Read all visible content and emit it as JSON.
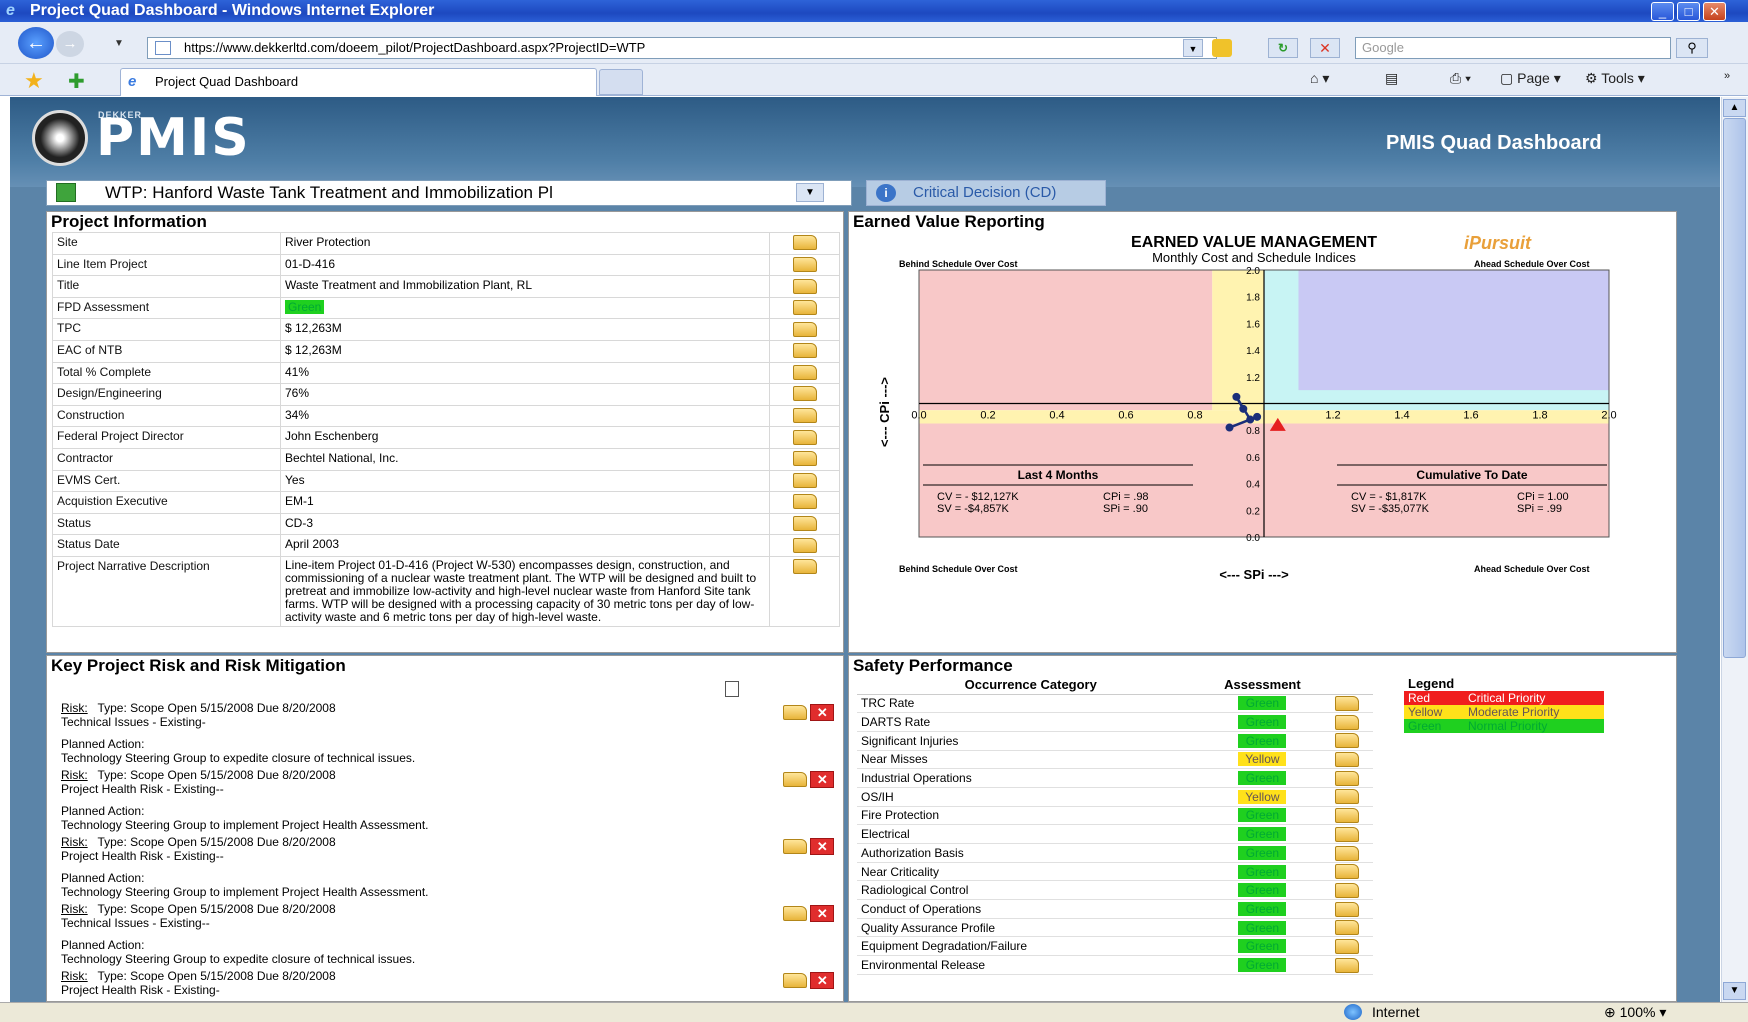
{
  "window": {
    "title": "Project Quad Dashboard - Windows Internet Explorer"
  },
  "browser": {
    "url": "https://www.dekkerltd.com/doeem_pilot/ProjectDashboard.aspx?ProjectID=WTP",
    "search_placeholder": "Google",
    "tab_label": "Project Quad Dashboard",
    "page_menu": "Page",
    "tools_menu": "Tools"
  },
  "header": {
    "logo_small": "DEKKER",
    "logo_text": "PMIS",
    "title": "PMIS Quad Dashboard"
  },
  "selector": {
    "project": "WTP: Hanford Waste Tank Treatment and Immobilization Pl",
    "cd_button": "Critical Decision (CD)"
  },
  "project_info": {
    "title": "Project Information",
    "rows": [
      {
        "label": "Site",
        "value": "River Protection"
      },
      {
        "label": "Line Item Project",
        "value": "01-D-416"
      },
      {
        "label": "Title",
        "value": "Waste Treatment and Immobilization Plant, RL"
      },
      {
        "label": "FPD Assessment",
        "value": "Green"
      },
      {
        "label": "TPC",
        "value": "$ 12,263M"
      },
      {
        "label": "EAC of NTB",
        "value": "$ 12,263M"
      },
      {
        "label": "Total % Complete",
        "value": "41%"
      },
      {
        "label": "Design/Engineering",
        "value": "76%"
      },
      {
        "label": "Construction",
        "value": "34%"
      },
      {
        "label": "Federal Project Director",
        "value": "John Eschenberg"
      },
      {
        "label": "Contractor",
        "value": "Bechtel National, Inc."
      },
      {
        "label": "EVMS Cert.",
        "value": "Yes"
      },
      {
        "label": "Acquistion Executive",
        "value": "EM-1"
      },
      {
        "label": "Status",
        "value": "CD-3"
      },
      {
        "label": "Status Date",
        "value": "April 2003"
      },
      {
        "label": "Project Narrative Description",
        "value": "Line-item Project 01-D-416 (Project W-530) encompasses design, construction, and commissioning of a nuclear waste treatment plant. The WTP will be designed and built to pretreat and immobilize low-activity and high-level nuclear waste from Hanford Site tank farms. WTP will be designed with a processing capacity of 30 metric tons per day of low-activity waste and 6 metric tons per day of high-level waste."
      }
    ]
  },
  "earned_value": {
    "title": "Earned Value Reporting"
  },
  "chart_data": {
    "type": "scatter",
    "title": "EARNED VALUE MANAGEMENT",
    "subtitle": "Monthly Cost and Schedule Indices",
    "brand": "iPursuit",
    "xlabel": "<--- SPi --->",
    "ylabel": "<--- CPi --->",
    "xlim": [
      0,
      2.0
    ],
    "ylim": [
      0,
      2.0
    ],
    "xticks": [
      "0.0",
      "0.2",
      "0.4",
      "0.6",
      "0.8",
      "1.0",
      "1.2",
      "1.4",
      "1.6",
      "1.8",
      "2.0"
    ],
    "yticks": [
      "0.0",
      "0.2",
      "0.4",
      "0.6",
      "0.8",
      "1.0",
      "1.2",
      "1.4",
      "1.6",
      "1.8",
      "2.0"
    ],
    "quadrant_labels": {
      "top_left": "Behind Schedule Over Cost",
      "top_right": "Ahead Schedule Over Cost",
      "bottom_left": "Behind Schedule Over Cost",
      "bottom_right": "Ahead Schedule Over Cost"
    },
    "series": [
      {
        "points": [
          [
            0.94,
            0.96
          ],
          [
            0.92,
            1.05
          ],
          [
            0.96,
            0.88
          ],
          [
            0.9,
            0.82
          ],
          [
            0.98,
            0.9
          ]
        ]
      }
    ],
    "current_point": [
      1.04,
      0.84
    ],
    "last_4_months": {
      "heading": "Last 4 Months",
      "cv": "CV = - $12,127K",
      "cpi": "CPi = .98",
      "sv": "SV = -$4,857K",
      "spi": "SPi = .90"
    },
    "cumulative": {
      "heading": "Cumulative To Date",
      "cv": "CV = - $1,817K",
      "cpi": "CPi = 1.00",
      "sv": "SV = -$35,077K",
      "spi": "SPi = .99"
    }
  },
  "risk": {
    "title": "Key Project Risk and Risk Mitigation",
    "items": [
      {
        "risk_label": "Risk:",
        "line": "Type: Scope    Open 5/15/2008 Due 8/20/2008",
        "name": "Technical Issues - Existing-",
        "action_label": "Planned Action:",
        "action": "Technology Steering Group to expedite closure of technical issues."
      },
      {
        "risk_label": "Risk:",
        "line": "Type: Scope    Open 5/15/2008 Due 8/20/2008",
        "name": "Project Health Risk - Existing--",
        "action_label": "Planned Action:",
        "action": "Technology Steering Group to implement Project Health Assessment."
      },
      {
        "risk_label": "Risk:",
        "line": "Type: Scope    Open 5/15/2008 Due 8/20/2008",
        "name": "Project Health Risk - Existing--",
        "action_label": "Planned Action:",
        "action": "Technology Steering Group to implement Project Health Assessment."
      },
      {
        "risk_label": "Risk:",
        "line": "Type: Scope    Open 5/15/2008 Due 8/20/2008",
        "name": "Technical Issues - Existing--",
        "action_label": "Planned Action:",
        "action": "Technology Steering Group to expedite closure of technical issues."
      },
      {
        "risk_label": "Risk:",
        "line": "Type: Scope    Open 5/15/2008 Due 8/20/2008",
        "name": "Project Health Risk - Existing-",
        "action_label": "",
        "action": ""
      }
    ]
  },
  "safety": {
    "title": "Safety Performance",
    "col_category": "Occurrence Category",
    "col_assessment": "Assessment",
    "rows": [
      {
        "cat": "TRC Rate",
        "val": "Green"
      },
      {
        "cat": "DARTS Rate",
        "val": "Green"
      },
      {
        "cat": "Significant Injuries",
        "val": "Green"
      },
      {
        "cat": "Near Misses",
        "val": "Yellow"
      },
      {
        "cat": "Industrial Operations",
        "val": "Green"
      },
      {
        "cat": "OS/IH",
        "val": "Yellow"
      },
      {
        "cat": "Fire Protection",
        "val": "Green"
      },
      {
        "cat": "Electrical",
        "val": "Green"
      },
      {
        "cat": "Authorization Basis",
        "val": "Green"
      },
      {
        "cat": "Near Criticality",
        "val": "Green"
      },
      {
        "cat": "Radiological Control",
        "val": "Green"
      },
      {
        "cat": "Conduct of Operations",
        "val": "Green"
      },
      {
        "cat": "Quality Assurance Profile",
        "val": "Green"
      },
      {
        "cat": "Equipment Degradation/Failure",
        "val": "Green"
      },
      {
        "cat": "Environmental Release",
        "val": "Green"
      }
    ],
    "legend_title": "Legend",
    "legend": [
      {
        "color": "Red",
        "meaning": "Critical Priority"
      },
      {
        "color": "Yellow",
        "meaning": "Moderate Priority"
      },
      {
        "color": "Green",
        "meaning": "Normal Priority"
      }
    ]
  },
  "statusbar": {
    "zone": "Internet",
    "zoom": "100%"
  },
  "colors": {
    "red": "#f01e1e",
    "yellow": "#ffe11a",
    "green": "#1fd01f"
  }
}
